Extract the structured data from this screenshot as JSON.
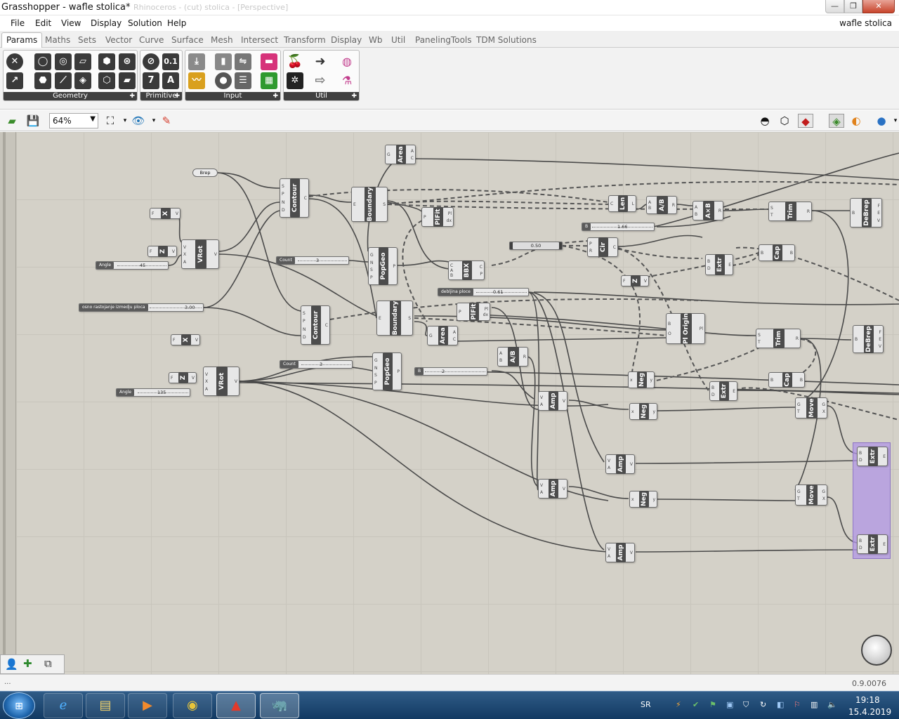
{
  "window": {
    "title": "Grasshopper - wafle stolica*",
    "ghost_title": "Rhinoceros - (cut) stolica - [Perspective]",
    "document_name": "wafle stolica",
    "controls": {
      "minimize": "—",
      "maximize": "❐",
      "close": "✕"
    }
  },
  "menu": [
    "File",
    "Edit",
    "View",
    "Display",
    "Solution",
    "Help"
  ],
  "tabs": [
    "Params",
    "Maths",
    "Sets",
    "Vector",
    "Curve",
    "Surface",
    "Mesh",
    "Intersect",
    "Transform",
    "Display",
    "Wb",
    "Util",
    "PanelingTools",
    "TDM Solutions"
  ],
  "ribbon": {
    "panels": [
      "Geometry",
      "Primitive",
      "Input",
      "Util"
    ],
    "primitive_icons": [
      "0.1",
      "7",
      "A"
    ]
  },
  "toolbar": {
    "zoom": "64%"
  },
  "canvas": {
    "components": [
      {
        "id": "area1",
        "label": "Area",
        "inputs": [
          "G"
        ],
        "outputs": [
          "A",
          "C"
        ]
      },
      {
        "id": "contour1",
        "label": "Contour",
        "inputs": [
          "S",
          "P",
          "N",
          "D"
        ],
        "outputs": [
          "C"
        ]
      },
      {
        "id": "boundary1",
        "label": "Boundary",
        "inputs": [
          "E"
        ],
        "outputs": [
          "S"
        ]
      },
      {
        "id": "plfit1",
        "label": "PlFit",
        "inputs": [
          "P"
        ],
        "outputs": [
          "Pl",
          "dx"
        ]
      },
      {
        "id": "popgeo1",
        "label": "PopGeo",
        "inputs": [
          "G",
          "N",
          "S",
          "P"
        ],
        "outputs": [
          "P"
        ]
      },
      {
        "id": "bbx",
        "label": "BBX",
        "inputs": [
          "C",
          "A",
          "B"
        ],
        "outputs": [
          "C",
          "P"
        ]
      },
      {
        "id": "len",
        "label": "Len",
        "inputs": [
          "C"
        ],
        "outputs": [
          "L"
        ]
      },
      {
        "id": "adivb1",
        "label": "A/B",
        "inputs": [
          "A",
          "B"
        ],
        "outputs": [
          "R"
        ]
      },
      {
        "id": "axb",
        "label": "A×B",
        "inputs": [
          "A",
          "B"
        ],
        "outputs": [
          "R"
        ]
      },
      {
        "id": "trim1",
        "label": "Trim",
        "inputs": [
          "S",
          "T"
        ],
        "outputs": [
          "R"
        ]
      },
      {
        "id": "debrep1",
        "label": "DeBrep",
        "inputs": [
          "B"
        ],
        "outputs": [
          "F",
          "E",
          "V"
        ]
      },
      {
        "id": "cir",
        "label": "Cir",
        "inputs": [
          "P",
          "R"
        ],
        "outputs": [
          "C"
        ]
      },
      {
        "id": "extr1",
        "label": "Extr",
        "inputs": [
          "B",
          "D"
        ],
        "outputs": [
          "E"
        ]
      },
      {
        "id": "cap1",
        "label": "Cap",
        "inputs": [
          "B"
        ],
        "outputs": [
          "B"
        ]
      },
      {
        "id": "fz1",
        "label": "Z",
        "inputs": [
          "F"
        ],
        "outputs": [
          "V"
        ]
      },
      {
        "id": "vrot1",
        "label": "VRot",
        "inputs": [
          "V",
          "X",
          "A"
        ],
        "outputs": [
          "V"
        ]
      },
      {
        "id": "fx1",
        "label": "X",
        "inputs": [
          "F"
        ],
        "outputs": [
          "V"
        ]
      },
      {
        "id": "fz0",
        "label": "Z",
        "inputs": [
          "F"
        ],
        "outputs": [
          "V"
        ]
      },
      {
        "id": "contour2",
        "label": "Contour",
        "inputs": [
          "S",
          "P",
          "N",
          "D"
        ],
        "outputs": [
          "C"
        ]
      },
      {
        "id": "boundary2",
        "label": "Boundary",
        "inputs": [
          "E"
        ],
        "outputs": [
          "S"
        ]
      },
      {
        "id": "plfit2",
        "label": "PlFit",
        "inputs": [
          "P"
        ],
        "outputs": [
          "Pl",
          "dx"
        ]
      },
      {
        "id": "area2",
        "label": "Area",
        "inputs": [
          "G"
        ],
        "outputs": [
          "A",
          "C"
        ]
      },
      {
        "id": "plorigin",
        "label": "Pl Origin",
        "inputs": [
          "B",
          "O"
        ],
        "outputs": [
          "Pl"
        ]
      },
      {
        "id": "extr2",
        "label": "Extr",
        "inputs": [
          "B",
          "D"
        ],
        "outputs": [
          "E"
        ]
      },
      {
        "id": "trim2",
        "label": "Trim",
        "inputs": [
          "S",
          "T"
        ],
        "outputs": [
          "R"
        ]
      },
      {
        "id": "debrep2",
        "label": "DeBrep",
        "inputs": [
          "B"
        ],
        "outputs": [
          "F",
          "E",
          "V"
        ]
      },
      {
        "id": "cap2",
        "label": "Cap",
        "inputs": [
          "B"
        ],
        "outputs": [
          "B"
        ]
      },
      {
        "id": "fx2",
        "label": "X",
        "inputs": [
          "F"
        ],
        "outputs": [
          "V"
        ]
      },
      {
        "id": "fz2",
        "label": "Z",
        "inputs": [
          "F"
        ],
        "outputs": [
          "V"
        ]
      },
      {
        "id": "vrot2",
        "label": "VRot",
        "inputs": [
          "V",
          "X",
          "A"
        ],
        "outputs": [
          "V"
        ]
      },
      {
        "id": "popgeo2",
        "label": "PopGeo",
        "inputs": [
          "G",
          "N",
          "S",
          "P"
        ],
        "outputs": [
          "P"
        ]
      },
      {
        "id": "adivb2",
        "label": "A/B",
        "inputs": [
          "A",
          "B"
        ],
        "outputs": [
          "R"
        ]
      },
      {
        "id": "neg1",
        "label": "Neg",
        "inputs": [
          "x"
        ],
        "outputs": [
          "y"
        ]
      },
      {
        "id": "amp1",
        "label": "Amp",
        "inputs": [
          "V",
          "A"
        ],
        "outputs": [
          "V"
        ]
      },
      {
        "id": "neg2",
        "label": "Neg",
        "inputs": [
          "x"
        ],
        "outputs": [
          "y"
        ]
      },
      {
        "id": "move1",
        "label": "Move",
        "inputs": [
          "G",
          "T"
        ],
        "outputs": [
          "G",
          "X"
        ]
      },
      {
        "id": "amp2",
        "label": "Amp",
        "inputs": [
          "V",
          "A"
        ],
        "outputs": [
          "V"
        ]
      },
      {
        "id": "extr3",
        "label": "Extr",
        "inputs": [
          "B",
          "D"
        ],
        "outputs": [
          "E"
        ]
      },
      {
        "id": "amp3",
        "label": "Amp",
        "inputs": [
          "V",
          "A"
        ],
        "outputs": [
          "V"
        ]
      },
      {
        "id": "neg3",
        "label": "Neg",
        "inputs": [
          "x"
        ],
        "outputs": [
          "y"
        ]
      },
      {
        "id": "move2",
        "label": "Move",
        "inputs": [
          "G",
          "T"
        ],
        "outputs": [
          "G",
          "X"
        ]
      },
      {
        "id": "amp4",
        "label": "Amp",
        "inputs": [
          "V",
          "A"
        ],
        "outputs": [
          "V"
        ]
      },
      {
        "id": "extr4",
        "label": "Extr",
        "inputs": [
          "B",
          "D"
        ],
        "outputs": [
          "E"
        ]
      }
    ],
    "params": {
      "brep": "Brep"
    },
    "sliders": {
      "angle1": {
        "name": "Angle",
        "value": "45"
      },
      "count1": {
        "name": "Count",
        "value": "3"
      },
      "spacing": {
        "name": "osno rastojanje izmedju ploca",
        "value": "3.00"
      },
      "val050": {
        "name": "",
        "value": "0.50"
      },
      "b166": {
        "name": "B",
        "value": "1.66"
      },
      "thickness": {
        "name": "debljina ploce",
        "value": "0.61"
      },
      "count2": {
        "name": "Count",
        "value": "3"
      },
      "angle2": {
        "name": "Angle",
        "value": "135"
      },
      "b2": {
        "name": "B",
        "value": "2"
      }
    }
  },
  "status": {
    "left": "...",
    "version": "0.9.0076"
  },
  "taskbar": {
    "language": "SR",
    "time": "19:18",
    "date": "15.4.2019"
  }
}
